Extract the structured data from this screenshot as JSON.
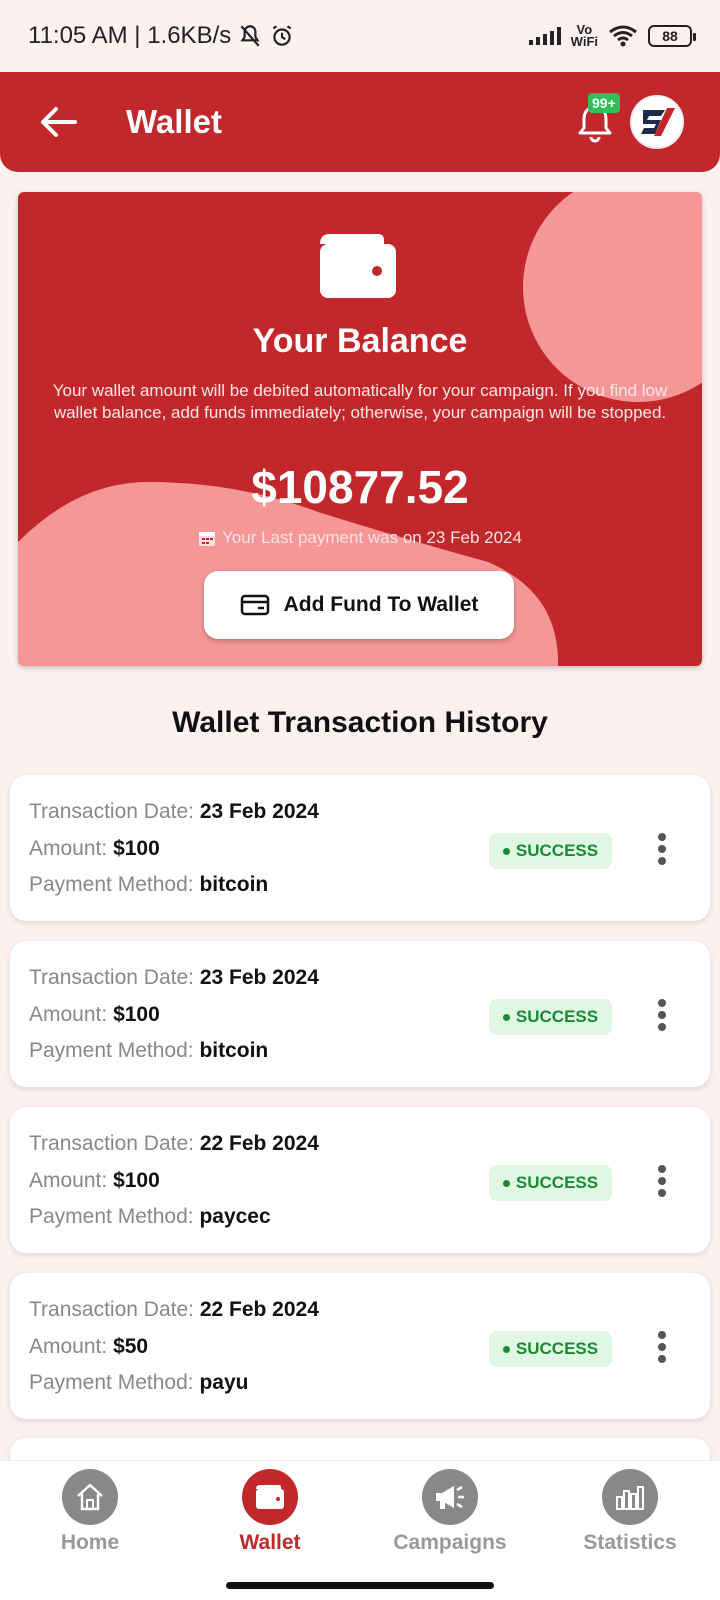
{
  "status_bar": {
    "time_speed": "11:05 AM | 1.6KB/s",
    "network_top": "Vo",
    "network_bottom": "WiFi",
    "battery": "88"
  },
  "header": {
    "title": "Wallet",
    "notification_count": "99+"
  },
  "balance_card": {
    "title": "Your Balance",
    "description": "Your wallet amount will be debited automatically for your campaign. If you find low wallet balance, add funds immediately; otherwise, your campaign will be stopped.",
    "amount": "$10877.52",
    "last_payment": "Your Last payment was on 23 Feb 2024",
    "add_fund_label": "Add Fund To Wallet"
  },
  "history": {
    "title": "Wallet Transaction History",
    "date_label": "Transaction Date:",
    "amount_label": "Amount:",
    "method_label": "Payment Method:",
    "transactions": [
      {
        "date": "23 Feb 2024",
        "amount": "$100",
        "method": "bitcoin",
        "status": "SUCCESS"
      },
      {
        "date": "23 Feb 2024",
        "amount": "$100",
        "method": "bitcoin",
        "status": "SUCCESS"
      },
      {
        "date": "22 Feb 2024",
        "amount": "$100",
        "method": "paycec",
        "status": "SUCCESS"
      },
      {
        "date": "22 Feb 2024",
        "amount": "$50",
        "method": "payu",
        "status": "SUCCESS"
      }
    ]
  },
  "bottom_nav": {
    "items": [
      {
        "label": "Home",
        "icon": "home-icon"
      },
      {
        "label": "Wallet",
        "icon": "wallet-icon"
      },
      {
        "label": "Campaigns",
        "icon": "megaphone-icon"
      },
      {
        "label": "Statistics",
        "icon": "bar-chart-icon"
      }
    ],
    "active": "Wallet"
  },
  "colors": {
    "primary": "#c1272b",
    "accent_light": "#f59797",
    "success_text": "#1c8a34",
    "success_bg": "#e0f7e4"
  }
}
